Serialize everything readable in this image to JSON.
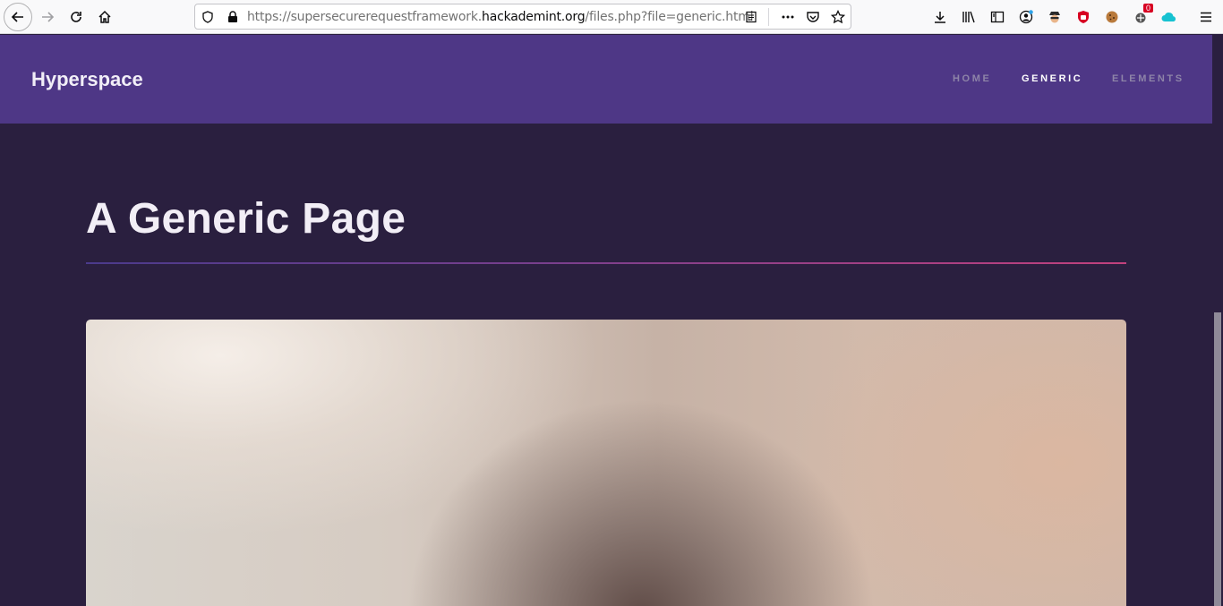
{
  "browser": {
    "url_prefix": "https://supersecurerequestframework.",
    "url_host": "hackademint.org",
    "url_path": "/files.php?file=generic.html",
    "notification_count": "0"
  },
  "site": {
    "brand": "Hyperspace",
    "nav": [
      {
        "label": "HOME",
        "active": false
      },
      {
        "label": "GENERIC",
        "active": true
      },
      {
        "label": "ELEMENTS",
        "active": false
      }
    ]
  },
  "main": {
    "title": "A Generic Page"
  },
  "colors": {
    "header_bg": "#4e3786",
    "page_bg": "#2a1f3f",
    "rule_start": "#4b3a8c",
    "rule_end": "#c2417d"
  },
  "icons": [
    "back-icon",
    "forward-icon",
    "reload-icon",
    "home-icon",
    "shield-icon",
    "lock-icon",
    "reader-view-icon",
    "more-icon",
    "pocket-icon",
    "bookmark-star-icon",
    "download-icon",
    "library-icon",
    "sidebar-icon",
    "account-icon",
    "spy-extension-icon",
    "ublock-icon",
    "cookie-icon",
    "extension-icon",
    "cloud-icon",
    "menu-icon"
  ]
}
